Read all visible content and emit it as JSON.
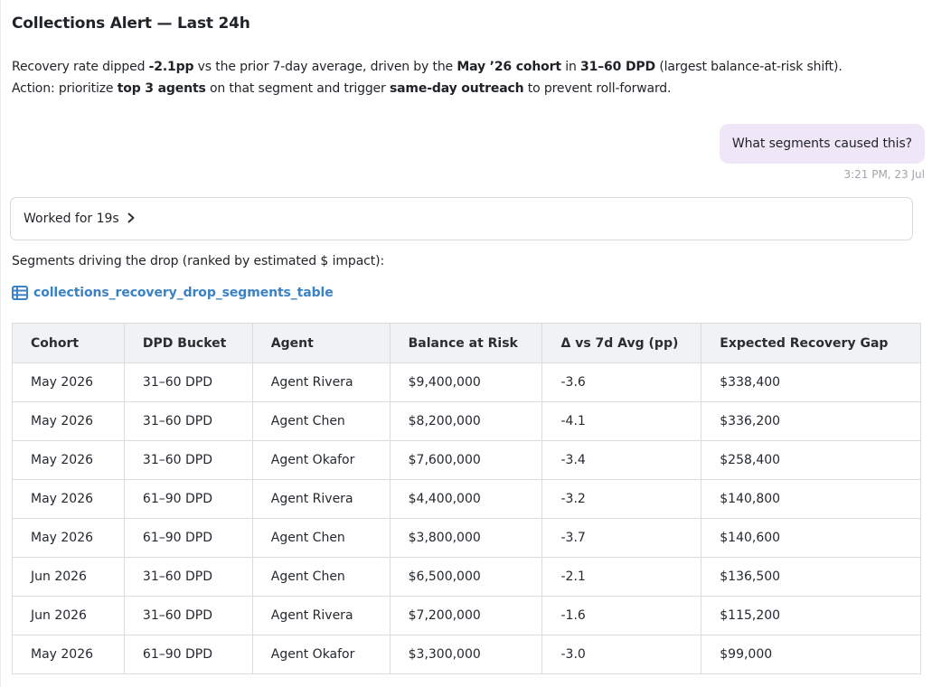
{
  "alert": {
    "title": "Collections Alert — Last 24h",
    "line1": {
      "t1": "Recovery rate dipped ",
      "b1": "-2.1pp",
      "t2": " vs the prior 7-day average, driven by the ",
      "b2": "May ’26 cohort",
      "t3": " in ",
      "b3": "31–60 DPD",
      "t4": " (largest balance-at-risk shift)."
    },
    "line2": {
      "t1": "Action: prioritize ",
      "b1": "top 3 agents",
      "t2": " on that segment and trigger ",
      "b2": "same-day outreach",
      "t3": " to prevent roll-forward."
    }
  },
  "user_message": {
    "text": "What segments caused this?",
    "time": "3:21 PM, 23 Jul"
  },
  "worked": {
    "label": "Worked for 19s",
    "chevron_icon": "chevron-right-icon"
  },
  "segments_intro": "Segments driving the drop (ranked by estimated $ impact):",
  "table_link": {
    "label": "collections_recovery_drop_segments_table",
    "icon": "table-icon",
    "color": "#3b82c4"
  },
  "table": {
    "headers": [
      "Cohort",
      "DPD Bucket",
      "Agent",
      "Balance at Risk",
      "Δ vs 7d Avg (pp)",
      "Expected Recovery Gap"
    ],
    "rows": [
      [
        "May 2026",
        "31–60 DPD",
        "Agent Rivera",
        "$9,400,000",
        "-3.6",
        "$338,400"
      ],
      [
        "May 2026",
        "31–60 DPD",
        "Agent Chen",
        "$8,200,000",
        "-4.1",
        "$336,200"
      ],
      [
        "May 2026",
        "31–60 DPD",
        "Agent Okafor",
        "$7,600,000",
        "-3.4",
        "$258,400"
      ],
      [
        "May 2026",
        "61–90 DPD",
        "Agent Rivera",
        "$4,400,000",
        "-3.2",
        "$140,800"
      ],
      [
        "May 2026",
        "61–90 DPD",
        "Agent Chen",
        "$3,800,000",
        "-3.7",
        "$140,600"
      ],
      [
        "Jun 2026",
        "31–60 DPD",
        "Agent Chen",
        "$6,500,000",
        "-2.1",
        "$136,500"
      ],
      [
        "Jun 2026",
        "31–60 DPD",
        "Agent Rivera",
        "$7,200,000",
        "-1.6",
        "$115,200"
      ],
      [
        "May 2026",
        "61–90 DPD",
        "Agent Okafor",
        "$3,300,000",
        "-3.0",
        "$99,000"
      ]
    ]
  }
}
